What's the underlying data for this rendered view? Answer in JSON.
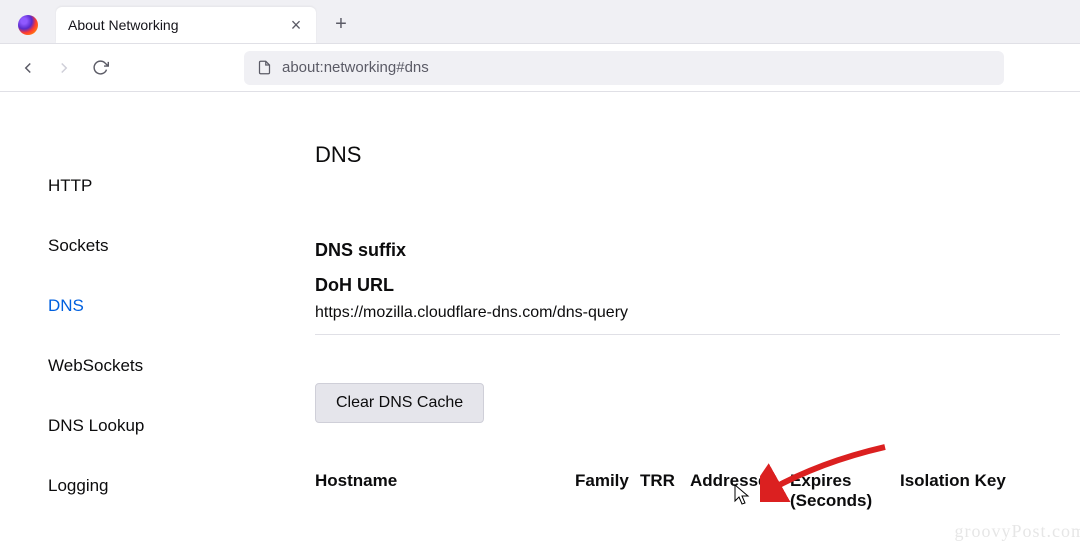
{
  "tab": {
    "title": "About Networking"
  },
  "toolbar": {
    "url": "about:networking#dns"
  },
  "sidebar": {
    "items": [
      {
        "label": "HTTP"
      },
      {
        "label": "Sockets"
      },
      {
        "label": "DNS"
      },
      {
        "label": "WebSockets"
      },
      {
        "label": "DNS Lookup"
      },
      {
        "label": "Logging"
      }
    ],
    "active_index": 2
  },
  "main": {
    "title": "DNS",
    "dns_suffix_label": "DNS suffix",
    "doh_url_label": "DoH URL",
    "doh_url_value": "https://mozilla.cloudflare-dns.com/dns-query",
    "clear_button": "Clear DNS Cache",
    "columns": {
      "hostname": "Hostname",
      "family": "Family",
      "trr": "TRR",
      "addresses": "Addresses",
      "expires": "Expires (Seconds)",
      "isolation": "Isolation Key"
    }
  },
  "watermark": "groovyPost.com"
}
